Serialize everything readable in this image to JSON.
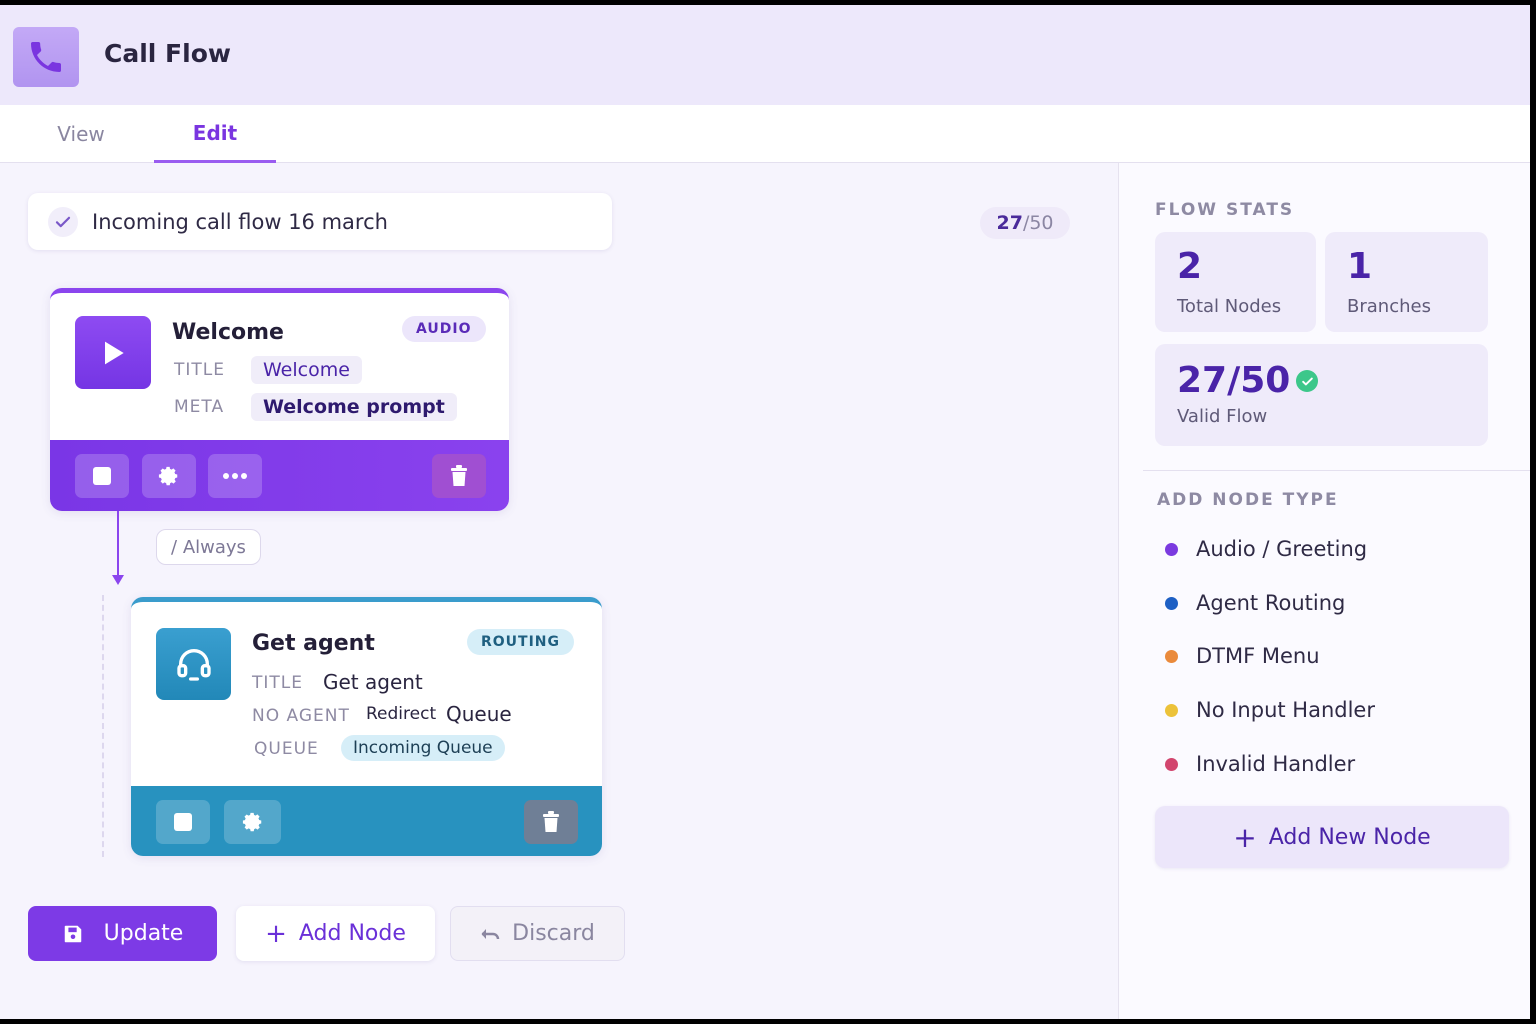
{
  "app": {
    "title": "Call Flow"
  },
  "tabs": [
    {
      "label": "View"
    },
    {
      "label": "Edit"
    }
  ],
  "flow": {
    "name": "Incoming call flow 16 march",
    "counter_used": "27",
    "counter_sep_total": "/50"
  },
  "nodes": [
    {
      "title": "Welcome",
      "badge": "AUDIO",
      "fields": [
        {
          "label": "TITLE",
          "value": "Welcome"
        },
        {
          "label": "META",
          "value": "Welcome prompt"
        }
      ]
    },
    {
      "title": "Get agent",
      "badge": "ROUTING",
      "fields": [
        {
          "label": "TITLE",
          "value": "Get agent"
        },
        {
          "label": "NO AGENT",
          "value_prefix": "Redirect",
          "value": "Queue"
        },
        {
          "label": "QUEUE",
          "value": "Incoming Queue"
        }
      ]
    }
  ],
  "edge": {
    "label": "/ Always"
  },
  "actions": {
    "update": "Update",
    "add_node": "Add Node",
    "discard": "Discard"
  },
  "sidebar": {
    "stats_title": "FLOW STATS",
    "stats": [
      {
        "value": "2",
        "label": "Total Nodes"
      },
      {
        "value": "1",
        "label": "Branches"
      },
      {
        "value": "27/50",
        "label": "Valid Flow"
      }
    ],
    "node_types_title": "ADD NODE TYPE",
    "node_types": [
      {
        "label": "Audio / Greeting",
        "color": "#7b3ae0"
      },
      {
        "label": "Agent Routing",
        "color": "#1d5fc4"
      },
      {
        "label": "DTMF Menu",
        "color": "#ea8a3c"
      },
      {
        "label": "No Input Handler",
        "color": "#ecc23a"
      },
      {
        "label": "Invalid Handler",
        "color": "#d2456e"
      }
    ],
    "add_new_node": "Add New Node"
  },
  "colors": {
    "accent": "#7d3ae6",
    "audio_bar": "#8b45ee",
    "routing_bar": "#2892bf",
    "valid": "#3cc78a"
  }
}
